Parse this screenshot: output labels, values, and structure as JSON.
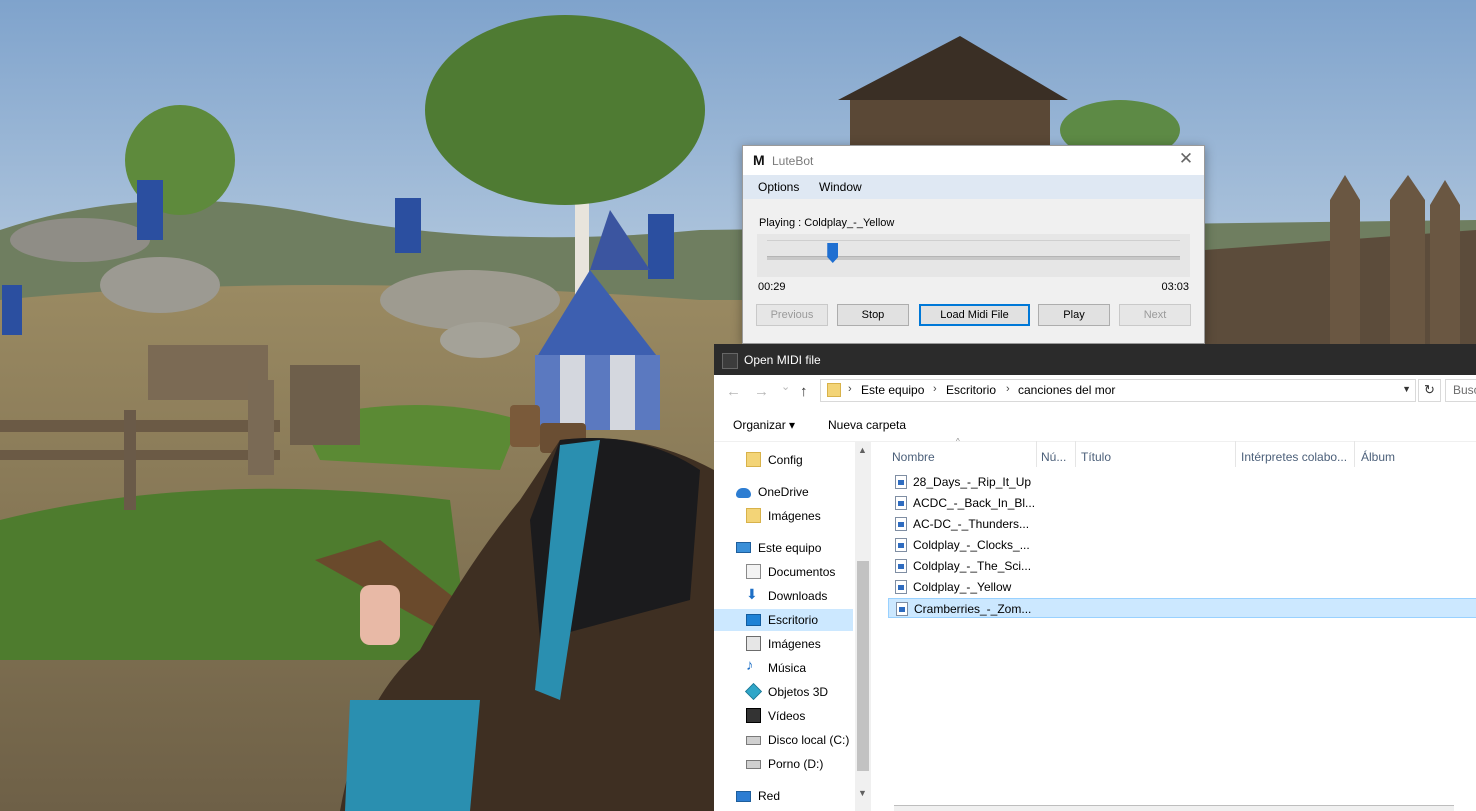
{
  "lutebot": {
    "title": "LuteBot",
    "logo": "M",
    "close_glyph": "✕",
    "menu": {
      "options": "Options",
      "window": "Window"
    },
    "now_playing": "Playing : Coldplay_-_Yellow",
    "elapsed": "00:29",
    "total": "03:03",
    "progress_fraction": 0.158,
    "buttons": {
      "previous": "Previous",
      "stop": "Stop",
      "load": "Load Midi File",
      "play": "Play",
      "next": "Next"
    }
  },
  "dialog": {
    "title": "Open MIDI file",
    "nav_buttons": {
      "back": "←",
      "forward": "→",
      "recent": "⌄",
      "up": "↑"
    },
    "breadcrumb": [
      "Este equipo",
      "Escritorio",
      "canciones del mor"
    ],
    "search_placeholder": "Busc",
    "toolbar": {
      "organize": "Organizar ▾",
      "new_folder": "Nueva carpeta"
    },
    "nav_items": [
      {
        "label": "Config",
        "icon": "folder-icon"
      },
      {
        "label": "OneDrive",
        "icon": "cloud-icon"
      },
      {
        "label": "Imágenes",
        "icon": "folder-icon"
      },
      {
        "label": "Este equipo",
        "icon": "computer-icon"
      },
      {
        "label": "Documentos",
        "icon": "documents-icon"
      },
      {
        "label": "Downloads",
        "icon": "download-icon"
      },
      {
        "label": "Escritorio",
        "icon": "desktop-icon",
        "selected": true
      },
      {
        "label": "Imágenes",
        "icon": "pictures-icon"
      },
      {
        "label": "Música",
        "icon": "music-icon"
      },
      {
        "label": "Objetos 3D",
        "icon": "cube-icon"
      },
      {
        "label": "Vídeos",
        "icon": "video-icon"
      },
      {
        "label": "Disco local (C:)",
        "icon": "drive-icon"
      },
      {
        "label": "Porno (D:)",
        "icon": "drive-icon"
      },
      {
        "label": "Red",
        "icon": "network-icon"
      }
    ],
    "columns": [
      "Nombre",
      "Nú...",
      "Título",
      "Intérpretes colabo...",
      "Álbum"
    ],
    "files": [
      "28_Days_-_Rip_It_Up",
      "ACDC_-_Back_In_Bl...",
      "AC-DC_-_Thunders...",
      "Coldplay_-_Clocks_...",
      "Coldplay_-_The_Sci...",
      "Coldplay_-_Yellow",
      "Cramberries_-_Zom..."
    ],
    "selected_file_index": 6
  },
  "colors": {
    "lutebot_menubar": "#dfe8f3",
    "slider_thumb": "#1f6fd1",
    "dialog_titlebar": "#2b2b2b",
    "selection": "#cce8ff",
    "focus_border": "#0078d7"
  }
}
